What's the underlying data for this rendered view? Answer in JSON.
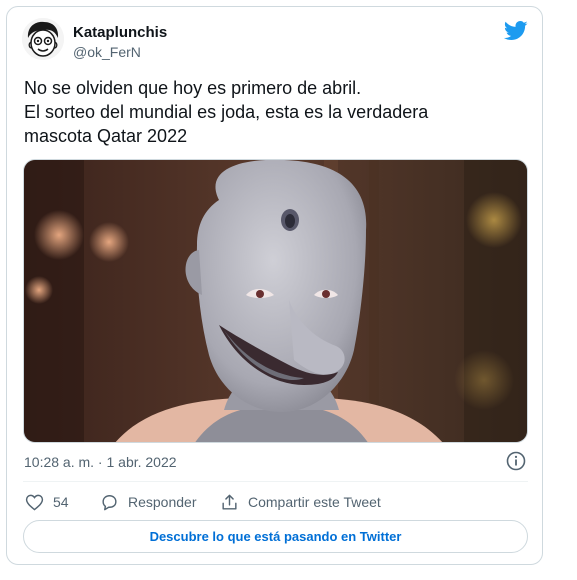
{
  "tweet": {
    "display_name": "Kataplunchis",
    "handle": "@ok_FerN",
    "text_lines": [
      "No se olviden que hoy es primero de abril.",
      "El sorteo del mundial es joda, esta es la verdadera",
      "mascota Qatar 2022"
    ],
    "timestamp": "10:28 a. m. · 1 abr. 2022",
    "like_count": "54",
    "reply_label": "Responder",
    "share_label": "Compartir este Tweet",
    "cta_label": "Descubre lo que está pasando en Twitter"
  },
  "icons": {
    "brand": "twitter-bird-icon",
    "info": "info-icon",
    "like": "heart-icon",
    "reply": "speech-bubble-icon",
    "share": "share-icon"
  },
  "colors": {
    "twitter_blue": "#1d9bf0",
    "link": "#006fd6",
    "muted": "#536471",
    "border": "#cfd9de"
  }
}
